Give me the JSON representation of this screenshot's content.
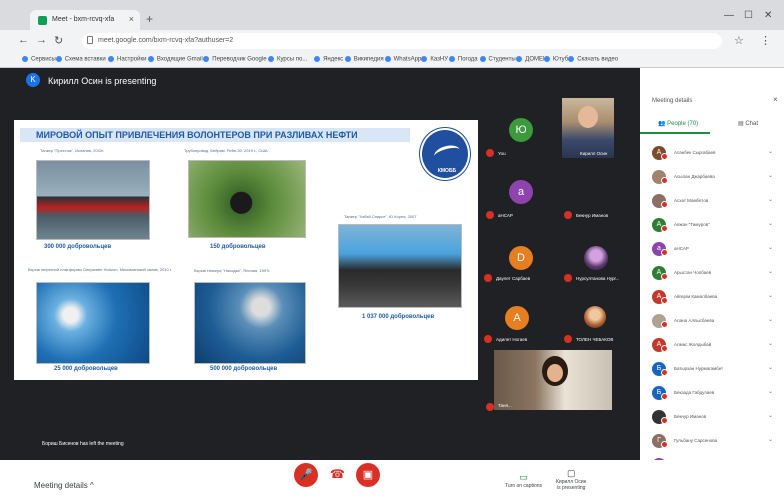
{
  "browser": {
    "tab_title": "Meet - bxm-rcvq-xfa",
    "address": "meet.google.com/bxm-rcvq-xfa?authuser=2",
    "bookmarks": [
      "Сервисы",
      "Схема вставки",
      "Настройки",
      "Входящие Gmail",
      "Переводчик Google",
      "Курсы по...",
      "Яндекс",
      "Википедия",
      "WhatsApp",
      "КазНУ",
      "Погода",
      "Студенты",
      "ДОМЕН",
      "Ютуб",
      "Скачать видео"
    ]
  },
  "meet": {
    "presenter_initial": "K",
    "presenter_text": "Кирилл Осин is presenting",
    "left_meeting": "Бориш Бисенов has left the meeting"
  },
  "slide": {
    "title": "МИРОВОЙ ОПЫТ ПРИВЛЕЧЕНИЯ ВОЛОНТЕРОВ ПРИ РАЗЛИВАХ НЕФТИ",
    "logo_text": "КМОББ",
    "items": [
      {
        "caption": "Танкер \"Престиж\", Испания, 2002г.",
        "volunteers": "300 000 добровольцев"
      },
      {
        "caption": "Трубопровод, Бейрам. Рейн-30, 2019 г., США",
        "volunteers": "150 добровольцев"
      },
      {
        "caption": "Танкер \"Хэбэй Спирит\", Ю.Корея, 2007",
        "volunteers": "1 037 000 добровольцев"
      },
      {
        "caption": "Взрыв нефтяной платформы Deepwater Horizon, Мексиканский залив, 2010 г.",
        "volunteers": "25 000 добровольцев"
      },
      {
        "caption": "Взрыв танкера \"Находка\", Япония, 1997г.",
        "volunteers": "500 000 добровольцев"
      }
    ]
  },
  "tiles": [
    {
      "name": "You",
      "initial": "Ю",
      "color": "#3c9a3c"
    },
    {
      "name": "Кирилл Осин",
      "initial": "",
      "color": ""
    },
    {
      "name": "аНСАР",
      "initial": "a",
      "color": "#8e44ad"
    },
    {
      "name": "Бекнур Иманов",
      "initial": "",
      "color": ""
    },
    {
      "name": "Даулет Сарбаев",
      "initial": "D",
      "color": "#e67e22"
    },
    {
      "name": "Нурсултанова Нург...",
      "initial": "",
      "color": ""
    },
    {
      "name": "Адилет Ногаев",
      "initial": "A",
      "color": "#e67e22"
    },
    {
      "name": "ТОЛЕН ЧЕБАКОВ",
      "initial": "",
      "color": ""
    },
    {
      "name": "Таня...",
      "initial": "",
      "color": ""
    }
  ],
  "panel": {
    "title": "Meeting details",
    "close": "×",
    "tab_people": "People (70)",
    "tab_chat": "Chat",
    "participants": [
      {
        "initial": "A",
        "color": "#7a4b2c",
        "name": "Асанбек Сыргабаев"
      },
      {
        "initial": "",
        "color": "#a0826d",
        "name": "Асылан Джарбаева"
      },
      {
        "initial": "",
        "color": "#8d6e63",
        "name": "Асхат Мамбетов"
      },
      {
        "initial": "A",
        "color": "#2e7d32",
        "name": "Аяжан \"Тимуров\""
      },
      {
        "initial": "a",
        "color": "#8e44ad",
        "name": "аНСАР"
      },
      {
        "initial": "A",
        "color": "#2e7d32",
        "name": "Арыстан Чолбаев"
      },
      {
        "initial": "A",
        "color": "#c0392b",
        "name": "Айгерім Камалбаева"
      },
      {
        "initial": "",
        "color": "#b0a090",
        "name": "Алана Алпысбаева"
      },
      {
        "initial": "A",
        "color": "#c0392b",
        "name": "Алмас Жолдыбай"
      },
      {
        "initial": "Б",
        "color": "#1565c0",
        "name": "Батырхан Нурмагамбет"
      },
      {
        "initial": "Б",
        "color": "#1565c0",
        "name": "Бекзада Габдулаев"
      },
      {
        "initial": "",
        "color": "#333333",
        "name": "Бекнур Иманов"
      },
      {
        "initial": "Г",
        "color": "#8d6e63",
        "name": "Гульбану Сарсенова"
      },
      {
        "initial": "Г",
        "color": "#8e44ad",
        "name": "Гульзат Ержанова"
      },
      {
        "initial": "Д",
        "color": "#2e7d32",
        "name": "Даулет Сарбаев"
      }
    ]
  },
  "bottom": {
    "meeting_details": "Meeting details",
    "chevron": "^",
    "captions": "Turn on captions",
    "presenting": "Кирилл Осин\nis presenting"
  }
}
